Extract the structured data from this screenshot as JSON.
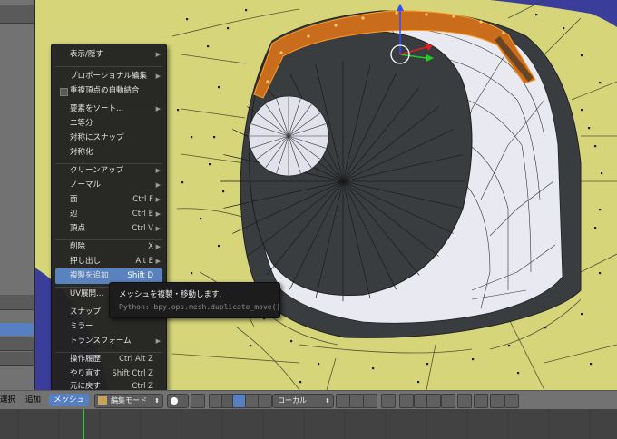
{
  "menu": {
    "items": [
      {
        "label": "表示/隠す",
        "shortcut": "",
        "arrow": true
      },
      {
        "label": "プロポーショナル編集",
        "shortcut": "",
        "arrow": true
      },
      {
        "label": "重複頂点の自動結合",
        "shortcut": "",
        "checkbox": true
      },
      {
        "label": "要素をソート...",
        "shortcut": "",
        "arrow": true
      },
      {
        "label": "二等分",
        "shortcut": ""
      },
      {
        "label": "対称にスナップ",
        "shortcut": ""
      },
      {
        "label": "対称化",
        "shortcut": ""
      },
      {
        "label": "クリーンアップ",
        "shortcut": "",
        "arrow": true
      },
      {
        "label": "ノーマル",
        "shortcut": "",
        "arrow": true
      },
      {
        "label": "面",
        "shortcut": "Ctrl F",
        "arrow": true
      },
      {
        "label": "辺",
        "shortcut": "Ctrl E",
        "arrow": true
      },
      {
        "label": "頂点",
        "shortcut": "Ctrl V",
        "arrow": true
      },
      {
        "label": "削除",
        "shortcut": "X",
        "arrow": true
      },
      {
        "label": "押し出し",
        "shortcut": "Alt E",
        "arrow": true
      },
      {
        "label": "複製を追加",
        "shortcut": "Shift D",
        "highlighted": true
      },
      {
        "label": "UV展開...",
        "shortcut": ""
      },
      {
        "label": "スナップ",
        "shortcut": ""
      },
      {
        "label": "ミラー",
        "shortcut": ""
      },
      {
        "label": "トランスフォーム",
        "shortcut": "",
        "arrow": true
      },
      {
        "label": "操作履歴",
        "shortcut": "Ctrl Alt Z"
      },
      {
        "label": "やり直す",
        "shortcut": "Shift Ctrl Z"
      },
      {
        "label": "元に戻す",
        "shortcut": "Ctrl Z"
      }
    ]
  },
  "tooltip": {
    "title": "メッシュを複製・移動します.",
    "python": "Python: bpy.ops.mesh.duplicate_move()"
  },
  "header": {
    "select": "選択",
    "add": "追加",
    "mesh": "メッシュ",
    "mode": "編集モード",
    "orientation": "ローカル"
  },
  "colors": {
    "accent": "#5680c2",
    "menu_bg": "#232323",
    "mesh_yellow": "#d6d57a",
    "viewport_bg": "#3b3d9b",
    "selection_orange": "#c96d1c"
  }
}
